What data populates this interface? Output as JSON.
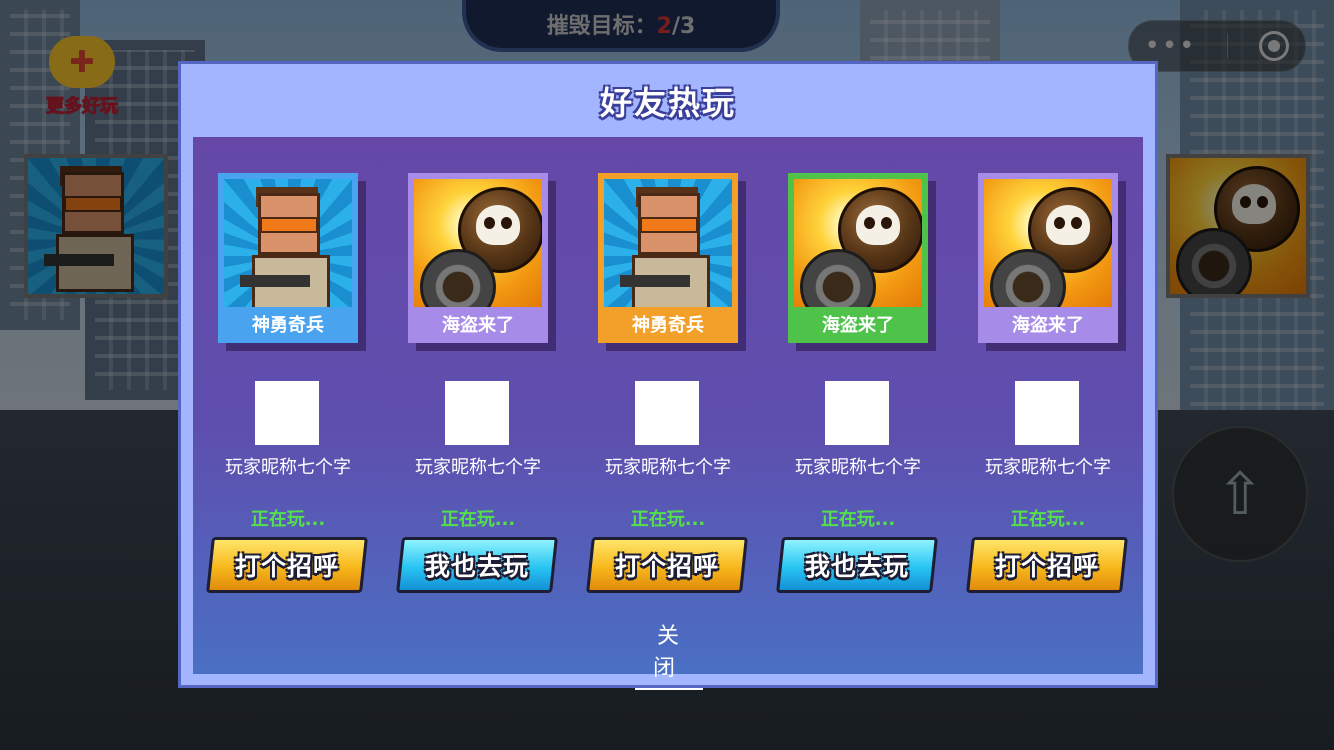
{
  "hud": {
    "target_label": "摧毁目标：",
    "target_current": "2",
    "target_sep_total": "/3"
  },
  "more_games": {
    "label": "更多好玩",
    "icon": "gamepad-icon"
  },
  "capsule": {
    "menu_icon": "more-dots-icon",
    "close_icon": "target-icon",
    "dots": "•••"
  },
  "jump_icon": "up-arrow-icon",
  "modal": {
    "title": "好友热玩",
    "close_label": "关闭",
    "friends": [
      {
        "game": "神勇奇兵",
        "game_art": "soldier",
        "card_color": "#4aa3ee",
        "nickname": "玩家昵称七个字",
        "status": "正在玩...",
        "action": "打个招呼",
        "action_style": "gold"
      },
      {
        "game": "海盗来了",
        "game_art": "pirate",
        "card_color": "#a78be8",
        "nickname": "玩家昵称七个字",
        "status": "正在玩...",
        "action": "我也去玩",
        "action_style": "blue"
      },
      {
        "game": "神勇奇兵",
        "game_art": "soldier",
        "card_color": "#f3a02a",
        "nickname": "玩家昵称七个字",
        "status": "正在玩...",
        "action": "打个招呼",
        "action_style": "gold"
      },
      {
        "game": "海盗来了",
        "game_art": "pirate",
        "card_color": "#4fc24a",
        "nickname": "玩家昵称七个字",
        "status": "正在玩...",
        "action": "我也去玩",
        "action_style": "blue"
      },
      {
        "game": "海盗来了",
        "game_art": "pirate",
        "card_color": "#a78be8",
        "nickname": "玩家昵称七个字",
        "status": "正在玩...",
        "action": "打个招呼",
        "action_style": "gold"
      }
    ]
  }
}
